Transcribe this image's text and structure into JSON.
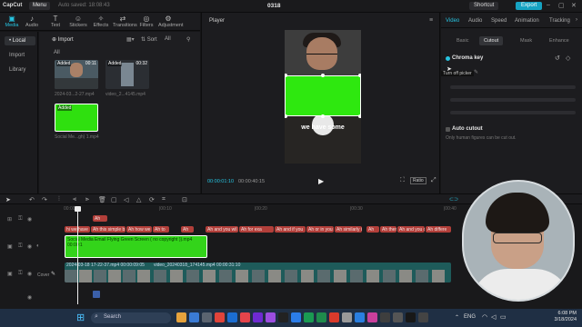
{
  "titlebar": {
    "logo": "CapCut",
    "menu": "Menu",
    "autosave": "Auto saved: 18:08:43",
    "project": "0318",
    "shortcut": "Shortcut",
    "export": "Export"
  },
  "tools": [
    {
      "label": "Media",
      "icon": "▣"
    },
    {
      "label": "Audio",
      "icon": "♪"
    },
    {
      "label": "Text",
      "icon": "T"
    },
    {
      "label": "Stickers",
      "icon": "☺"
    },
    {
      "label": "Effects",
      "icon": "✧"
    },
    {
      "label": "Transitions",
      "icon": "⇄"
    },
    {
      "label": "Filters",
      "icon": "◎"
    },
    {
      "label": "Adjustment",
      "icon": "⚙"
    }
  ],
  "sidenav": {
    "local": "• Local",
    "import": "Import",
    "library": "Library"
  },
  "media": {
    "import_label": "Import",
    "sort_label": "Sort",
    "filter_label": "All",
    "section_all": "All",
    "items": [
      {
        "badge": "Added",
        "duration": "00:11",
        "name": "2024-03...2-27.mp4"
      },
      {
        "badge": "Added",
        "duration": "00:32",
        "name": "video_2...4145.mp4"
      },
      {
        "badge": "Added",
        "duration": "",
        "name": "Social Me...gh) 1.mp4"
      }
    ]
  },
  "player": {
    "title": "Player",
    "caption": "we have some",
    "current_time": "00:00:01:10",
    "total_time": "00:00:40:15",
    "ratio_label": "Ratio"
  },
  "rpanel": {
    "tabs": [
      "Video",
      "Audio",
      "Speed",
      "Animation",
      "Tracking"
    ],
    "subtabs": [
      "Basic",
      "Cutout",
      "Mask",
      "Enhance"
    ],
    "chroma_key": "Chroma key",
    "color_picker_tooltip": "Turn off picker",
    "auto_cutout": "Auto cutout",
    "auto_cutout_desc": "Only human figures can be cut out."
  },
  "timeline": {
    "ruler": [
      "00:00",
      "|00:10",
      "|00:20",
      "|00:30",
      "|00:40"
    ],
    "text_clips": [
      "hi we have",
      "Ah this simple b",
      "Ah how we",
      "Ah to",
      "Ah",
      "Ah and you wil",
      "Ah for exa",
      "Ah and if you",
      "Ah or in you",
      "Ah similarly if I'm",
      "Ah",
      "Ah ther",
      "Ah and you c",
      "Ah differe"
    ],
    "top_clip": "Ah",
    "green_clip": "Social Media Email Flying Green Screen ( no copyright )).mp4  00:00:1",
    "main_clip_a": "2024-03-18 17-22-37.mp4  00:00:09:05",
    "main_clip_b": "video_20240318_174145.mp4  00:00:31:10",
    "cover_label": "Cover"
  },
  "taskbar": {
    "search": "Search",
    "time": "6:08 PM",
    "date": "3/18/2024",
    "lang": "ENG"
  }
}
